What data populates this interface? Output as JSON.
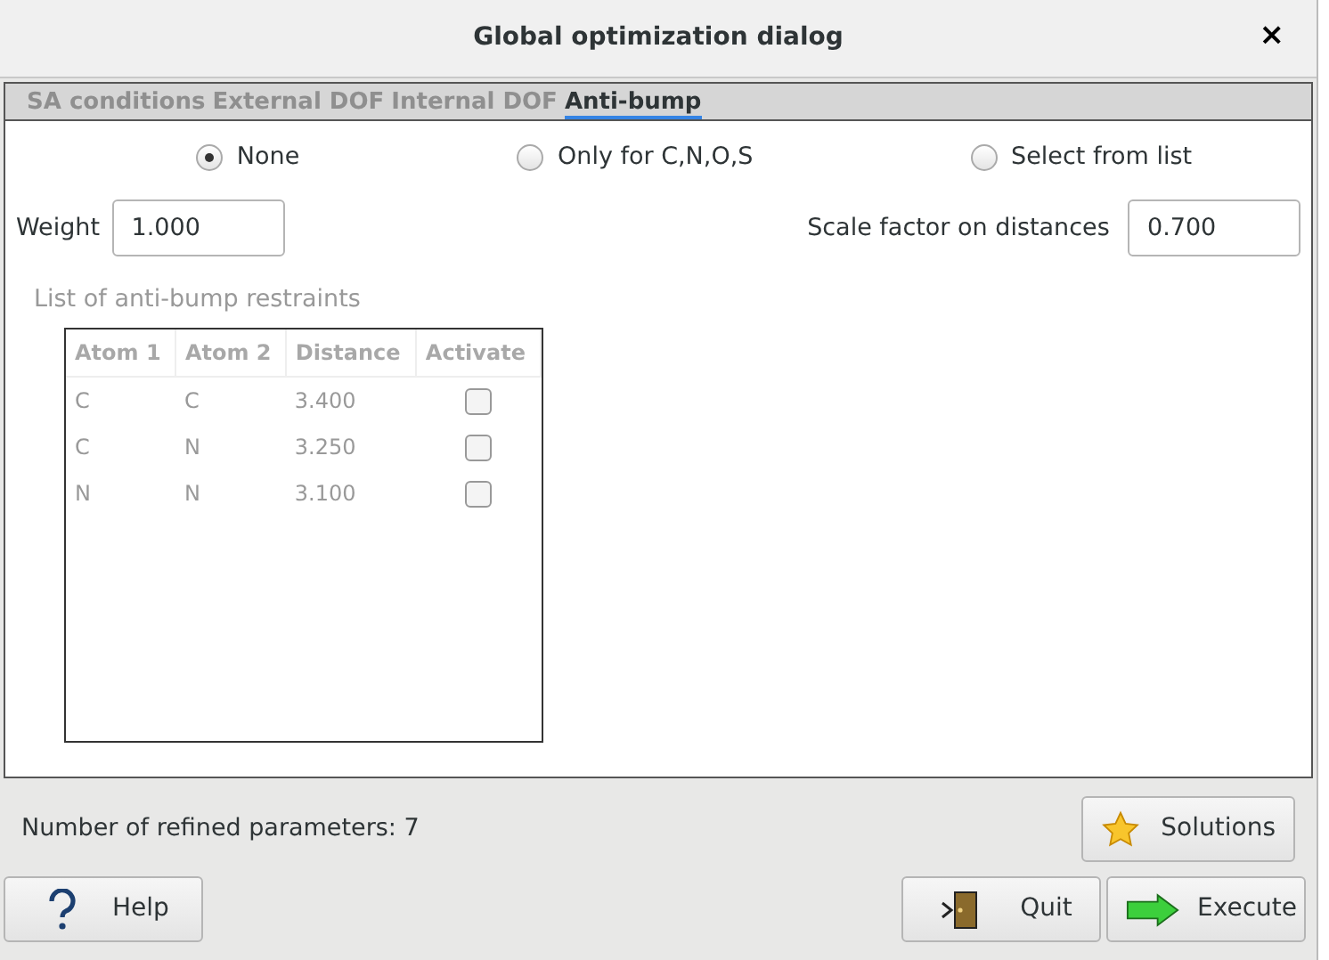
{
  "window": {
    "title": "Global optimization dialog",
    "close": "×"
  },
  "tabs": [
    {
      "label": "SA conditions",
      "selected": false
    },
    {
      "label": "External DOF",
      "selected": false
    },
    {
      "label": "Internal DOF",
      "selected": false
    },
    {
      "label": "Anti-bump",
      "selected": true
    }
  ],
  "mode_options": [
    {
      "label": "None",
      "selected": true
    },
    {
      "label": "Only for C,N,O,S",
      "selected": false
    },
    {
      "label": "Select from list",
      "selected": false
    }
  ],
  "weight": {
    "label": "Weight",
    "value": "1.000"
  },
  "scale_factor": {
    "label": "Scale factor on distances",
    "value": "0.700"
  },
  "restraints": {
    "title": "List of anti-bump restraints",
    "disabled": true,
    "columns": [
      "Atom 1",
      "Atom 2",
      "Distance",
      "Activate"
    ],
    "rows": [
      {
        "atom_1": "C",
        "atom_2": "C",
        "distance": "3.400",
        "checked": false
      },
      {
        "atom_1": "C",
        "atom_2": "N",
        "distance": "3.250",
        "checked": false
      },
      {
        "atom_1": "N",
        "atom_2": "N",
        "distance": "3.100",
        "checked": false
      }
    ]
  },
  "refined_parameters": {
    "label": "Number of refined parameters:",
    "value": "7"
  },
  "buttons": [
    {
      "kind": "solutions",
      "label": "Solutions"
    },
    {
      "kind": "help",
      "label": "Help"
    },
    {
      "kind": "quit",
      "label": "Quit"
    },
    {
      "kind": "execute",
      "label": "Execute"
    }
  ]
}
